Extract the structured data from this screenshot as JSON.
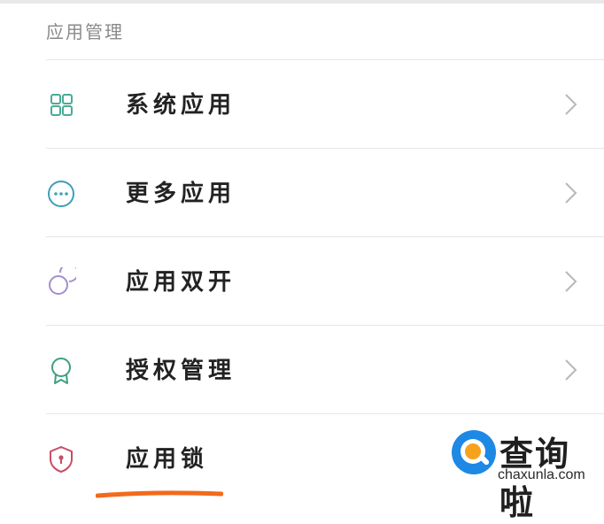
{
  "section": {
    "title": "应用管理"
  },
  "menu": {
    "items": [
      {
        "label": "系统应用",
        "icon": "grid-apps-icon",
        "color": "#4aaa97"
      },
      {
        "label": "更多应用",
        "icon": "more-dots-icon",
        "color": "#3ea0b8"
      },
      {
        "label": "应用双开",
        "icon": "dual-circles-icon",
        "color": "#a48ed0"
      },
      {
        "label": "授权管理",
        "icon": "badge-ribbon-icon",
        "color": "#3f9f7e"
      },
      {
        "label": "应用锁",
        "icon": "shield-lock-icon",
        "color": "#c94d66"
      }
    ]
  },
  "watermark": {
    "name": "查询啦",
    "domain": "chaxunla.com",
    "logo_colors": [
      "#1e88e5",
      "#f7a21c"
    ]
  },
  "annotation": {
    "underline_color": "#f26a1b"
  }
}
